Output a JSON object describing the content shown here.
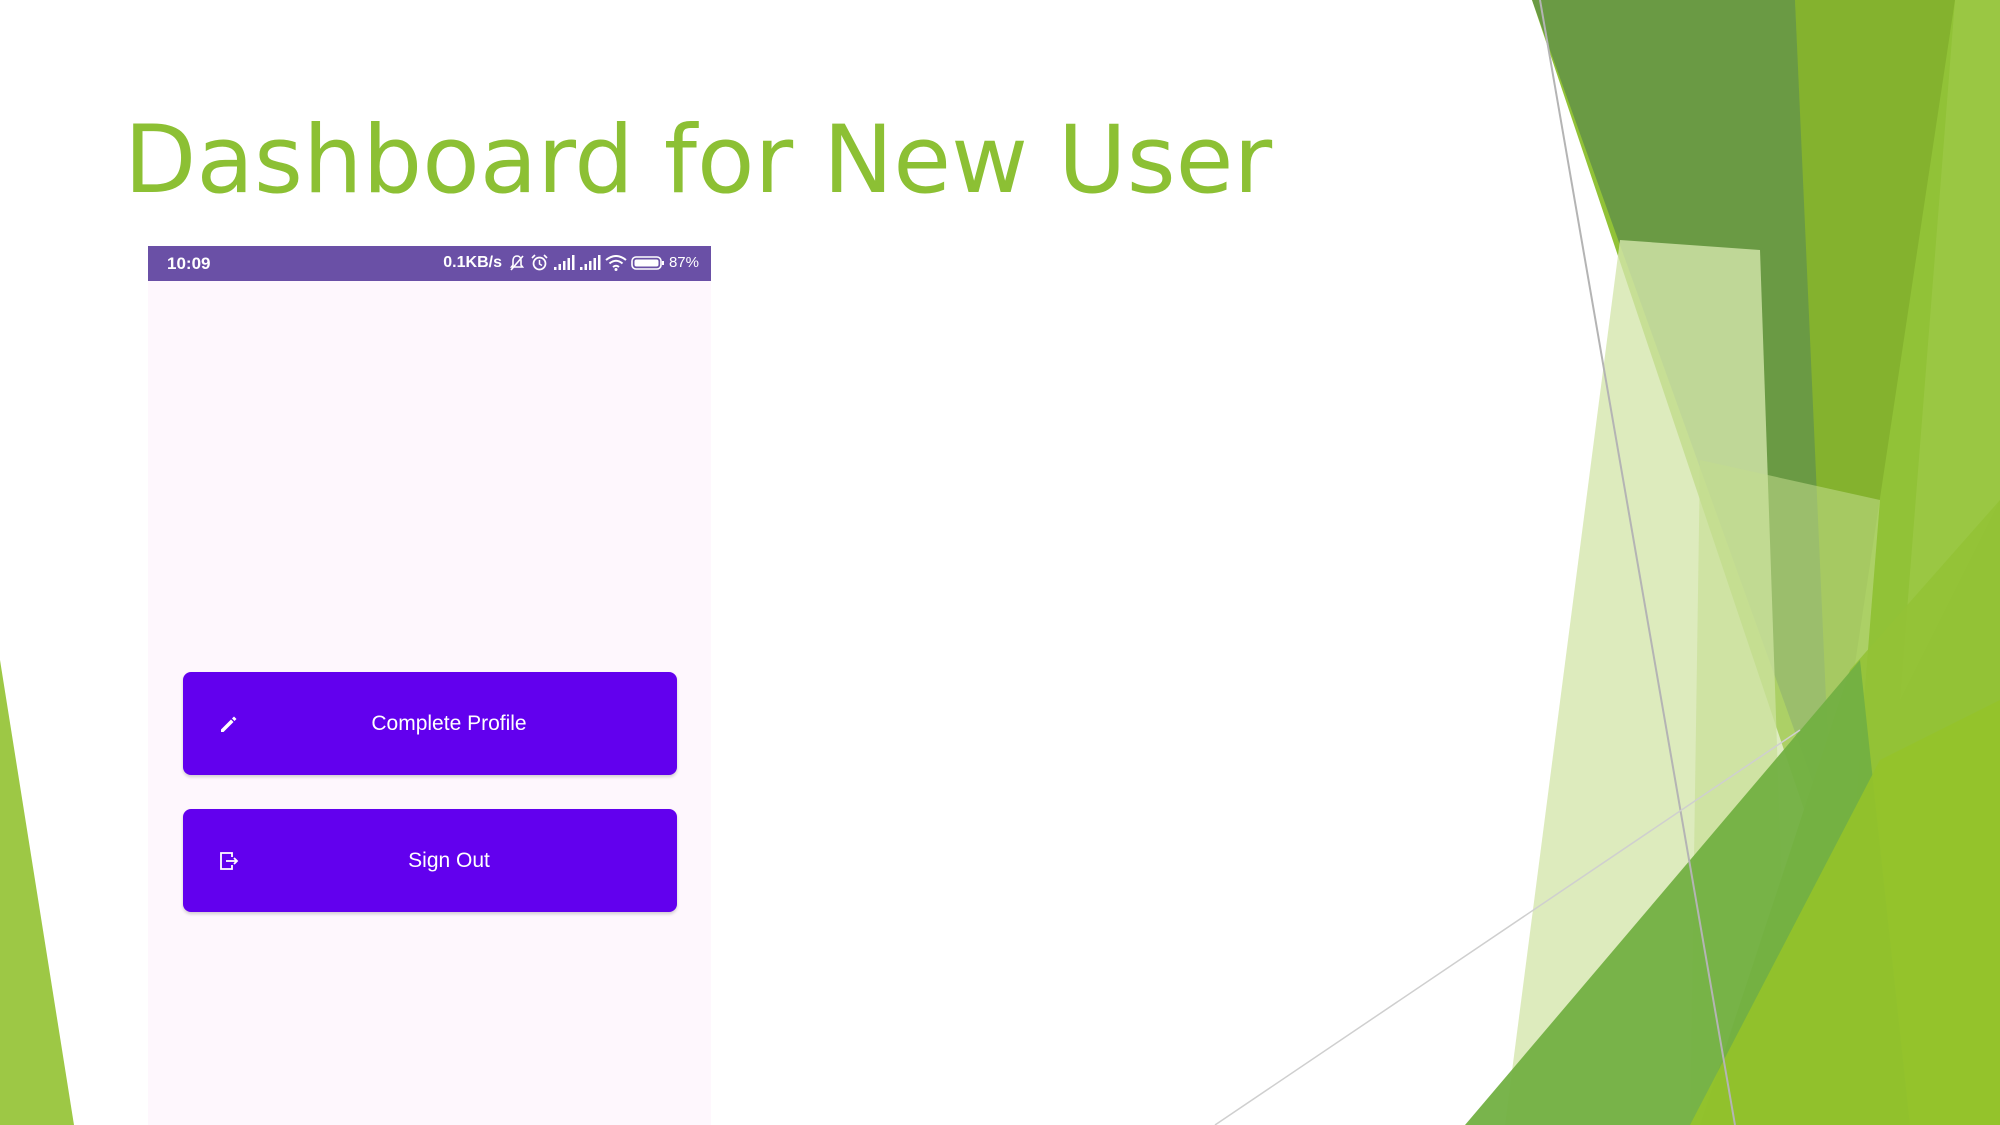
{
  "slide": {
    "title": "Dashboard for New User",
    "accent_color": "#8cc034"
  },
  "phone": {
    "status_bar": {
      "time": "10:09",
      "network_speed": "0.1KB/s",
      "battery_percent": "87%",
      "icons": [
        "bell-off-icon",
        "alarm-icon",
        "signal-icon",
        "signal-icon",
        "wifi-icon",
        "battery-icon"
      ],
      "color": "#6a50a6"
    },
    "background_color": "#fef7fd",
    "buttons": [
      {
        "label": "Complete Profile",
        "icon": "edit-pencil-icon"
      },
      {
        "label": "Sign Out",
        "icon": "sign-out-icon"
      }
    ],
    "button_color": "#6200ee"
  }
}
